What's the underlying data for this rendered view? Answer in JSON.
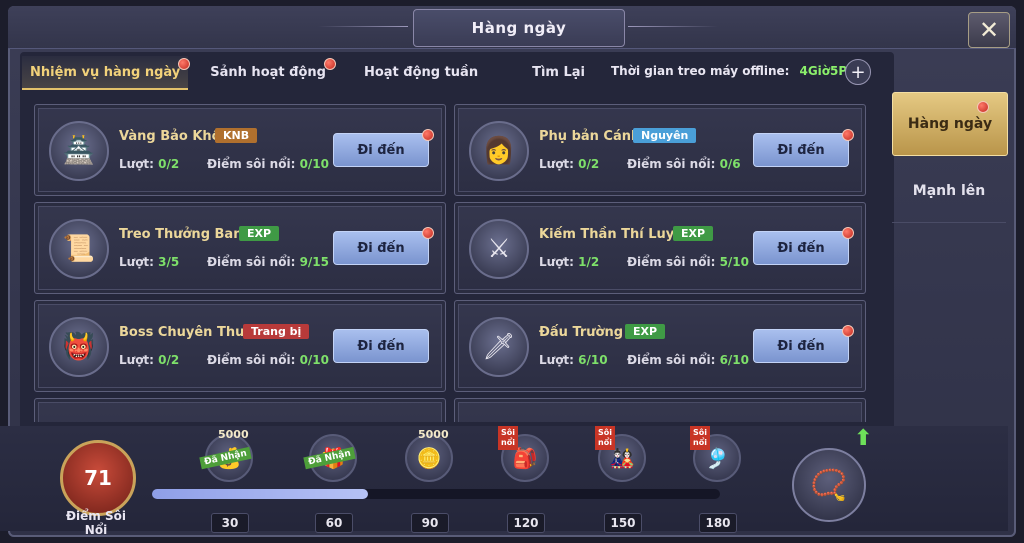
{
  "window": {
    "title": "Hàng ngày",
    "close_icon": "✕"
  },
  "tabs": [
    {
      "label": "Nhiệm vụ hàng ngày",
      "active": true,
      "badge": true
    },
    {
      "label": "Sảnh hoạt động",
      "active": false,
      "badge": true
    },
    {
      "label": "Hoạt động tuần",
      "active": false,
      "badge": false
    },
    {
      "label": "Tìm Lại",
      "active": false,
      "badge": false
    }
  ],
  "offline": {
    "label": "Thời gian treo máy offline:",
    "value": "4Giờ5Phút",
    "plus": "+"
  },
  "tasks": [
    {
      "name": "Vàng Bảo Khố",
      "tag": "KNB",
      "tag_type": "knb",
      "icon": "🏯",
      "turns_label": "Lượt:",
      "turns": "0/2",
      "points_label": "Điểm sôi nổi:",
      "points": "0/10",
      "button": "Đi đến"
    },
    {
      "name": "Phụ bản Cánh",
      "tag": "Nguyên",
      "tag_type": "nguyen",
      "icon": "👩",
      "turns_label": "Lượt:",
      "turns": "0/2",
      "points_label": "Điểm sôi nổi:",
      "points": "0/6",
      "button": "Đi đến"
    },
    {
      "name": "Treo Thưởng Bang",
      "tag": "EXP",
      "tag_type": "exp",
      "icon": "📜",
      "turns_label": "Lượt:",
      "turns": "3/5",
      "points_label": "Điểm sôi nổi:",
      "points": "9/15",
      "button": "Đi đến"
    },
    {
      "name": "Kiếm Thần Thí Luyện",
      "tag": "EXP",
      "tag_type": "exp",
      "icon": "⚔",
      "turns_label": "Lượt:",
      "turns": "1/2",
      "points_label": "Điểm sôi nổi:",
      "points": "5/10",
      "button": "Đi đến"
    },
    {
      "name": "Boss Chuyên Thuộc",
      "tag": "Trang bị",
      "tag_type": "trang",
      "icon": "👹",
      "turns_label": "Lượt:",
      "turns": "0/2",
      "points_label": "Điểm sôi nổi:",
      "points": "0/10",
      "button": "Đi đến"
    },
    {
      "name": "Đấu Trường",
      "tag": "EXP",
      "tag_type": "exp",
      "icon": "🗡",
      "turns_label": "Lượt:",
      "turns": "6/10",
      "points_label": "Điểm sôi nổi:",
      "points": "6/10",
      "button": "Đi đến"
    }
  ],
  "side_menu": [
    {
      "label": "Hàng ngày",
      "active": true,
      "badge": true
    },
    {
      "label": "Mạnh lên",
      "active": false,
      "badge": false
    }
  ],
  "activity": {
    "score": "71",
    "score_label": "Điểm Sôi Nổi",
    "progress_fraction": 0.38,
    "milestones": [
      {
        "value": "30",
        "amount": "5000",
        "claimed": "Đã Nhận",
        "icon": "💰"
      },
      {
        "value": "60",
        "amount": "",
        "claimed": "Đã Nhận",
        "icon": "🎁"
      },
      {
        "value": "90",
        "amount": "5000",
        "claimed": "",
        "icon": "🪙"
      },
      {
        "value": "120",
        "amount": "",
        "claimed": "",
        "flag": "Sôi nổi",
        "icon": "🎒"
      },
      {
        "value": "150",
        "amount": "",
        "claimed": "",
        "flag": "Sôi nổi",
        "icon": "🎎"
      },
      {
        "value": "180",
        "amount": "",
        "claimed": "",
        "flag": "Sôi nổi",
        "icon": "🎐"
      }
    ],
    "big_reward_icon": "📿",
    "up_arrow": "⬆"
  }
}
